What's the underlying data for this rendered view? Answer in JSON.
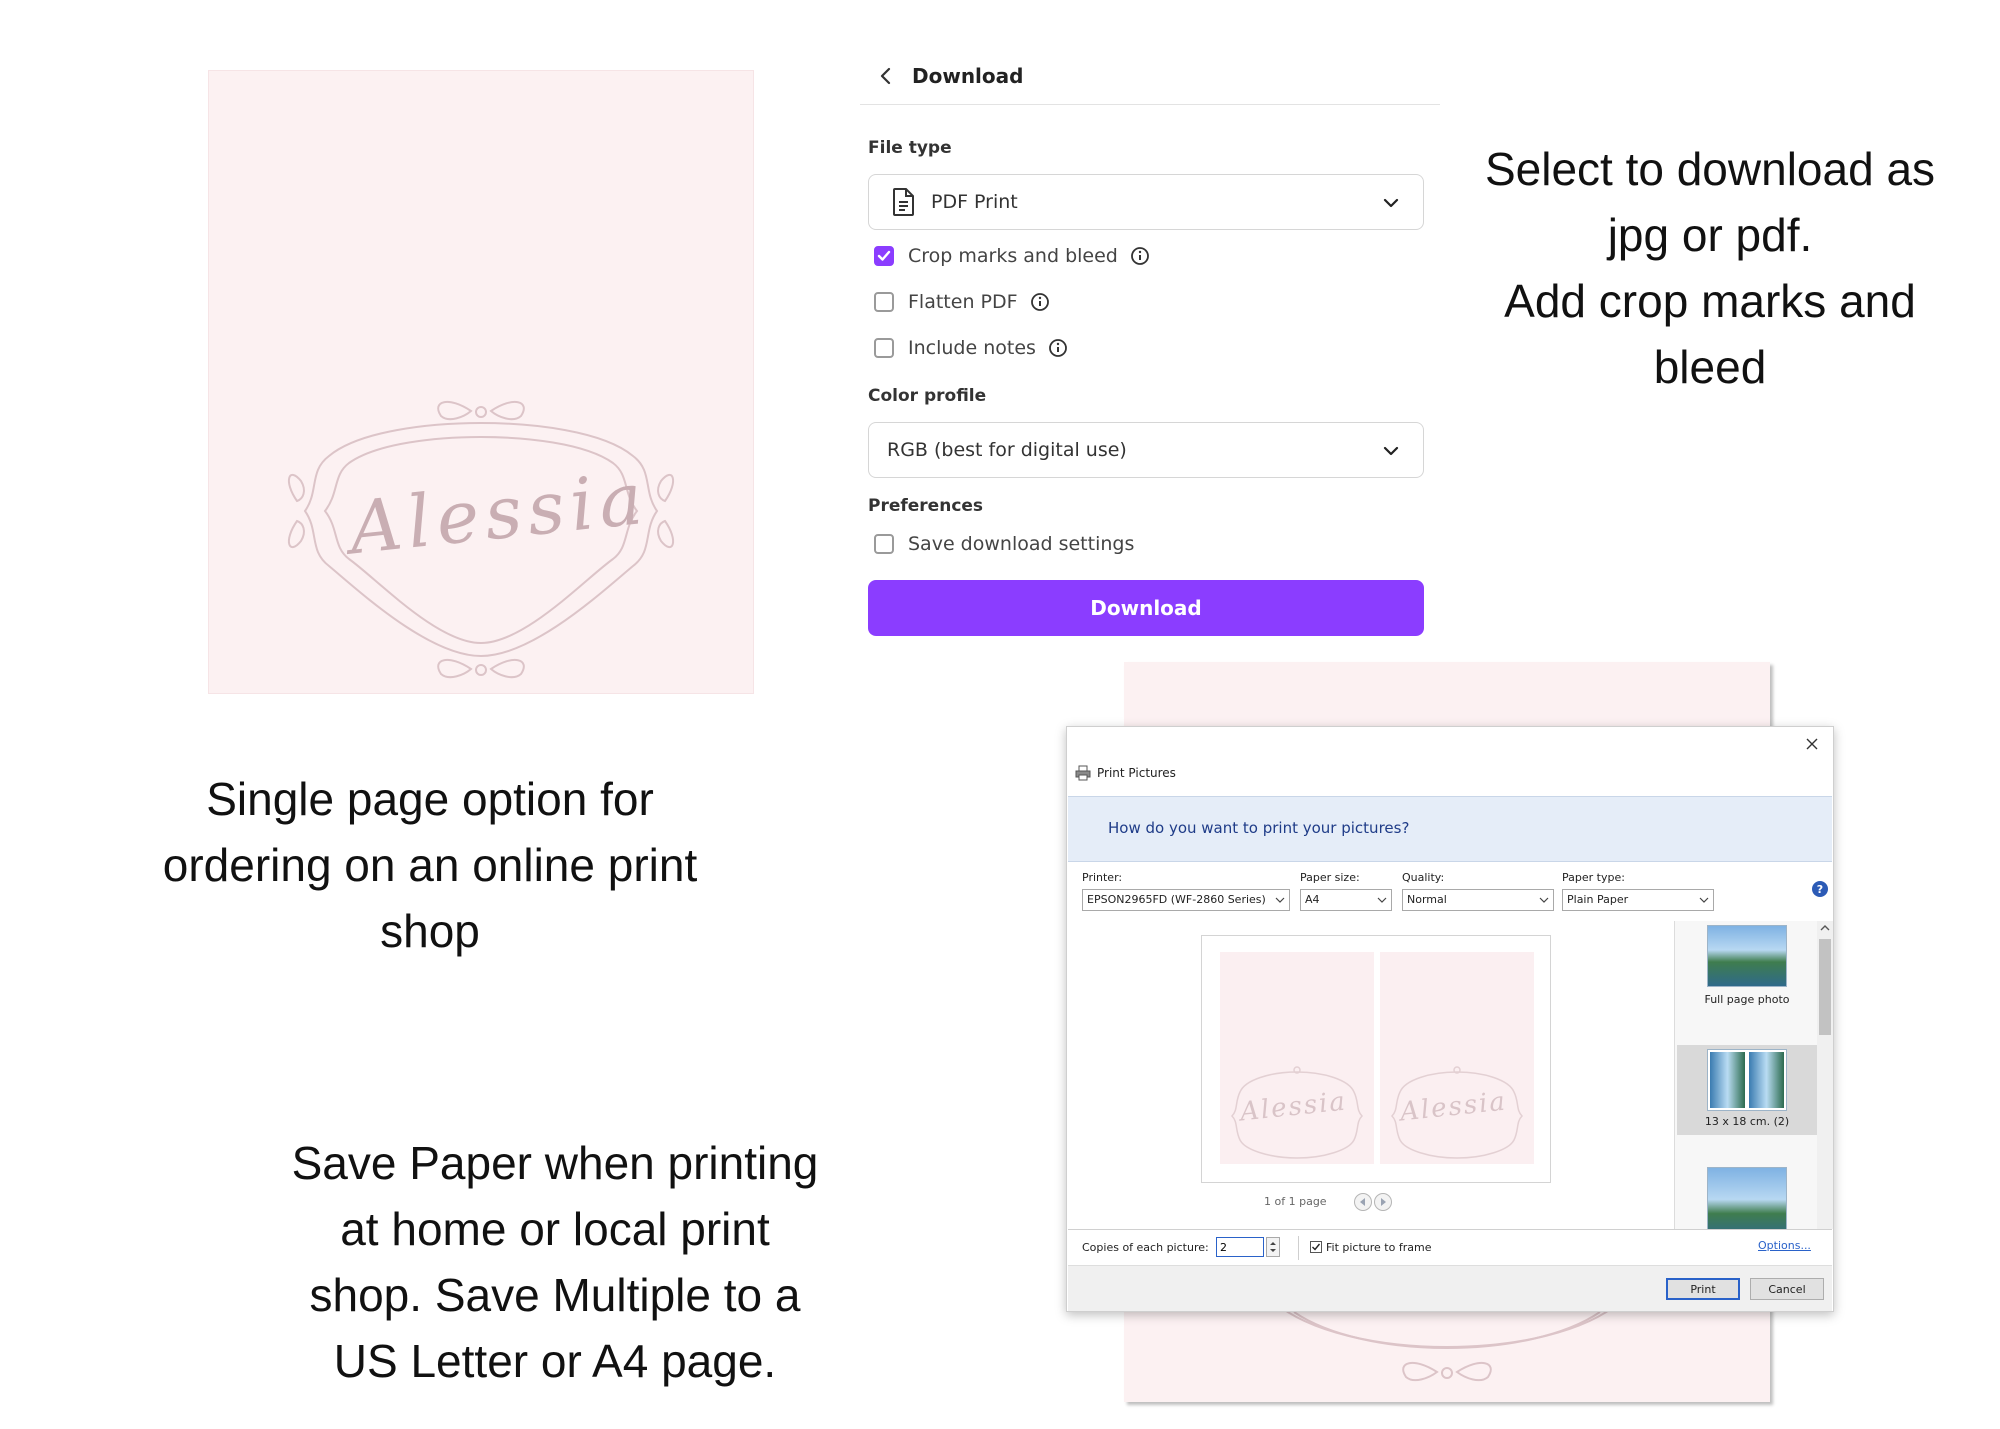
{
  "design": {
    "name_script": "Alessia",
    "colors": {
      "card_bg": "#fcf1f2",
      "frame_line": "#dcc4c8"
    }
  },
  "captions": {
    "right_top": [
      "Select to download as",
      "jpg or pdf.",
      "Add crop marks and",
      "bleed"
    ],
    "left_middle": [
      "Single page option for",
      "ordering on an online print",
      "shop"
    ],
    "left_bottom": [
      "Save Paper when printing",
      "at home or local print",
      "shop. Save Multiple to a",
      "US Letter or A4 page."
    ]
  },
  "download_panel": {
    "title": "Download",
    "file_type_label": "File type",
    "file_type_value": "PDF Print",
    "options": [
      {
        "label": "Crop marks and bleed",
        "checked": true
      },
      {
        "label": "Flatten PDF",
        "checked": false
      },
      {
        "label": "Include notes",
        "checked": false
      }
    ],
    "color_profile_label": "Color profile",
    "color_profile_value": "RGB (best for digital use)",
    "preferences_label": "Preferences",
    "save_settings_label": "Save download settings",
    "save_settings_checked": false,
    "download_button": "Download",
    "accent_color": "#8b3dff"
  },
  "print_dialog": {
    "window_title": "Print Pictures",
    "question": "How do you want to print your pictures?",
    "printer_label": "Printer:",
    "printer_value": "EPSON2965FD (WF-2860 Series)",
    "paper_size_label": "Paper size:",
    "paper_size_value": "A4",
    "quality_label": "Quality:",
    "quality_value": "Normal",
    "paper_type_label": "Paper type:",
    "paper_type_value": "Plain Paper",
    "help_symbol": "?",
    "preview_name": "Alessia",
    "page_count": "1 of 1 page",
    "layouts": [
      {
        "label": "Full page photo",
        "selected": false
      },
      {
        "label": "13 x 18 cm. (2)",
        "selected": true
      },
      {
        "label": "",
        "selected": false
      }
    ],
    "copies_label": "Copies of each picture:",
    "copies_value": "2",
    "fit_label": "Fit picture to frame",
    "fit_checked": true,
    "options_link": "Options...",
    "print_button": "Print",
    "cancel_button": "Cancel"
  }
}
